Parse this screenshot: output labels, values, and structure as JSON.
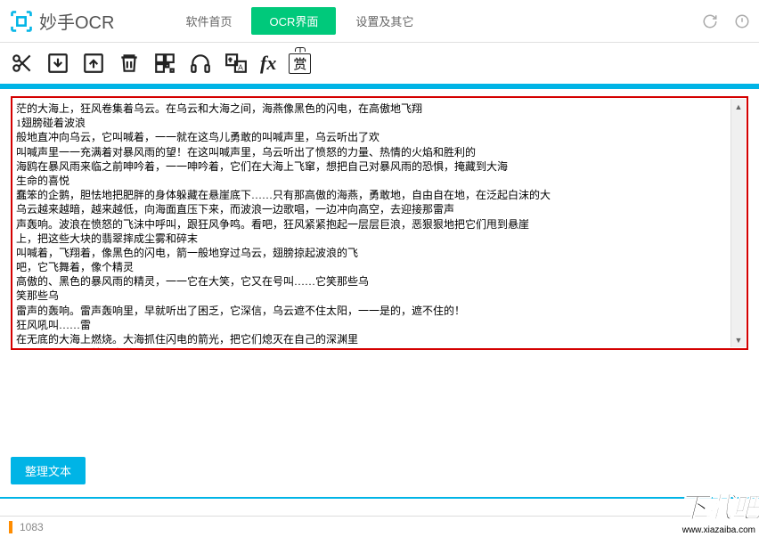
{
  "app": {
    "title": "妙手OCR"
  },
  "tabs": {
    "home": "软件首页",
    "ocr": "OCR界面",
    "settings": "设置及其它"
  },
  "ocr_text": "茫的大海上，狂风卷集着乌云。在乌云和大海之间，海燕像黑色的闪电，在高傲地飞翔\n1翅膀碰着波浪\n般地直冲向乌云，它叫喊着，一一就在这鸟儿勇敢的叫喊声里，乌云听出了欢\n叫喊声里一一充满着对暴风雨的望！在这叫喊声里，乌云听出了愤怒的力量、热情的火焰和胜利的\n海鸥在暴风雨来临之前呻吟着，一一呻吟着，它们在大海上飞窜，想把自己对暴风雨的恐惧，掩藏到大海\n生命的喜悦\n蠢笨的企鹅，胆怯地把肥胖的身体躲藏在悬崖底下……只有那高傲的海燕，勇敢地，自由自在地，在泛起白沫的大\n乌云越来越暗，越来越低，向海面直压下来，而波浪一边歌唱，一边冲向高空，去迎接那雷声\n声轰响。波浪在愤怒的飞沫中呼叫，跟狂风争鸣。看吧，狂风紧紧抱起一层层巨浪，恶狠狠地把它们甩到悬崖\n上，把这些大块的翡翠摔成尘雾和碎末\n叫喊着，飞翔着，像黑色的闪电，箭一般地穿过乌云，翅膀掠起波浪的飞\n吧，它飞舞着，像个精灵\n高傲的、黑色的暴风雨的精灵，一一它在大笑，它又在号叫……它笑那些乌\n笑那些乌\n雷声的轰响。雷声轰响里，早就听出了困乏，它深信，乌云遮不住太阳，一一是的，遮不住的！\n狂风吼叫……雷\n在无底的大海上燃烧。大海抓住闪电的箭光，把它们熄灭在自己的深渊里\n暴风雨！暴风雨就要来啦\n是勇敢的海燕，在怒吼的大海上，在闪电中间，高傲地飞翔；这是胜利的预言家在叫喊\n暴风雨来得更猛烈",
  "buttons": {
    "organize": "整理文本"
  },
  "status": {
    "count": "1083"
  },
  "watermark": {
    "main": "下载吧",
    "sub": "www.xiazaiba.com"
  }
}
